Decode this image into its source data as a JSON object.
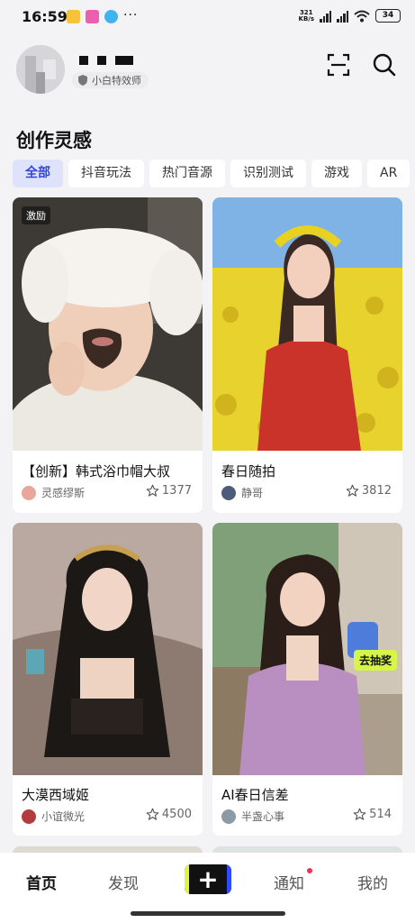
{
  "status": {
    "time": "16:59",
    "net_speed_value": "321",
    "net_speed_unit": "KB/s",
    "battery": "34"
  },
  "profile": {
    "badge_label": "小白特效师"
  },
  "section": {
    "title": "创作灵感"
  },
  "tabs": [
    {
      "label": "全部",
      "active": true
    },
    {
      "label": "抖音玩法"
    },
    {
      "label": "热门音源"
    },
    {
      "label": "识别测试"
    },
    {
      "label": "游戏"
    },
    {
      "label": "AR"
    }
  ],
  "cards": [
    {
      "title": "【创新】韩式浴巾帽大叔",
      "author": "灵感缪斯",
      "likes": "1377",
      "tag": "激励"
    },
    {
      "title": "春日随拍",
      "author": "静哥",
      "likes": "3812"
    },
    {
      "title": "大漠西域姬",
      "author": "小谊微光",
      "likes": "4500"
    },
    {
      "title": "AI春日信差",
      "author": "半盏心事",
      "likes": "514",
      "badge": "去抽奖"
    }
  ],
  "nav": {
    "home": "首页",
    "discover": "发现",
    "create": "+",
    "notify": "通知",
    "mine": "我的"
  },
  "colors": {
    "accent": "#3344dd",
    "tab_active_bg": "#dfe2fb",
    "create_left": "#e0f542",
    "create_right": "#2f4cff",
    "lottery": "#d6f44a",
    "notify_dot": "#f23050"
  }
}
